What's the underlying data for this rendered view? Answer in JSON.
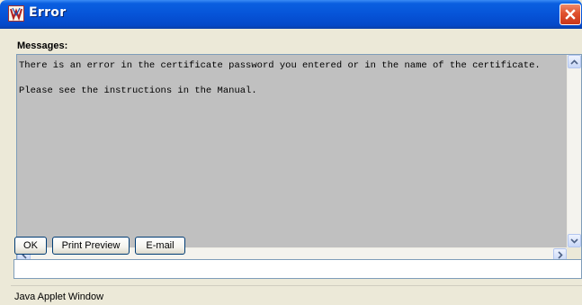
{
  "window": {
    "title": "Error",
    "icon": "java-applet-icon",
    "close_icon": "close-icon"
  },
  "messages": {
    "label": "Messages:",
    "lines": [
      "There is an error in the certificate password you entered or in the name of the certificate.",
      "Please see the instructions in the Manual."
    ]
  },
  "buttons": {
    "ok": "OK",
    "print_preview": "Print Preview",
    "email": "E-mail"
  },
  "status_field": {
    "value": ""
  },
  "footer": {
    "text": "Java Applet Window"
  },
  "colors": {
    "titlebar": "#0654d8",
    "close_button": "#e0512e",
    "message_background": "#c0c0c0",
    "window_background": "#ece9d8"
  }
}
